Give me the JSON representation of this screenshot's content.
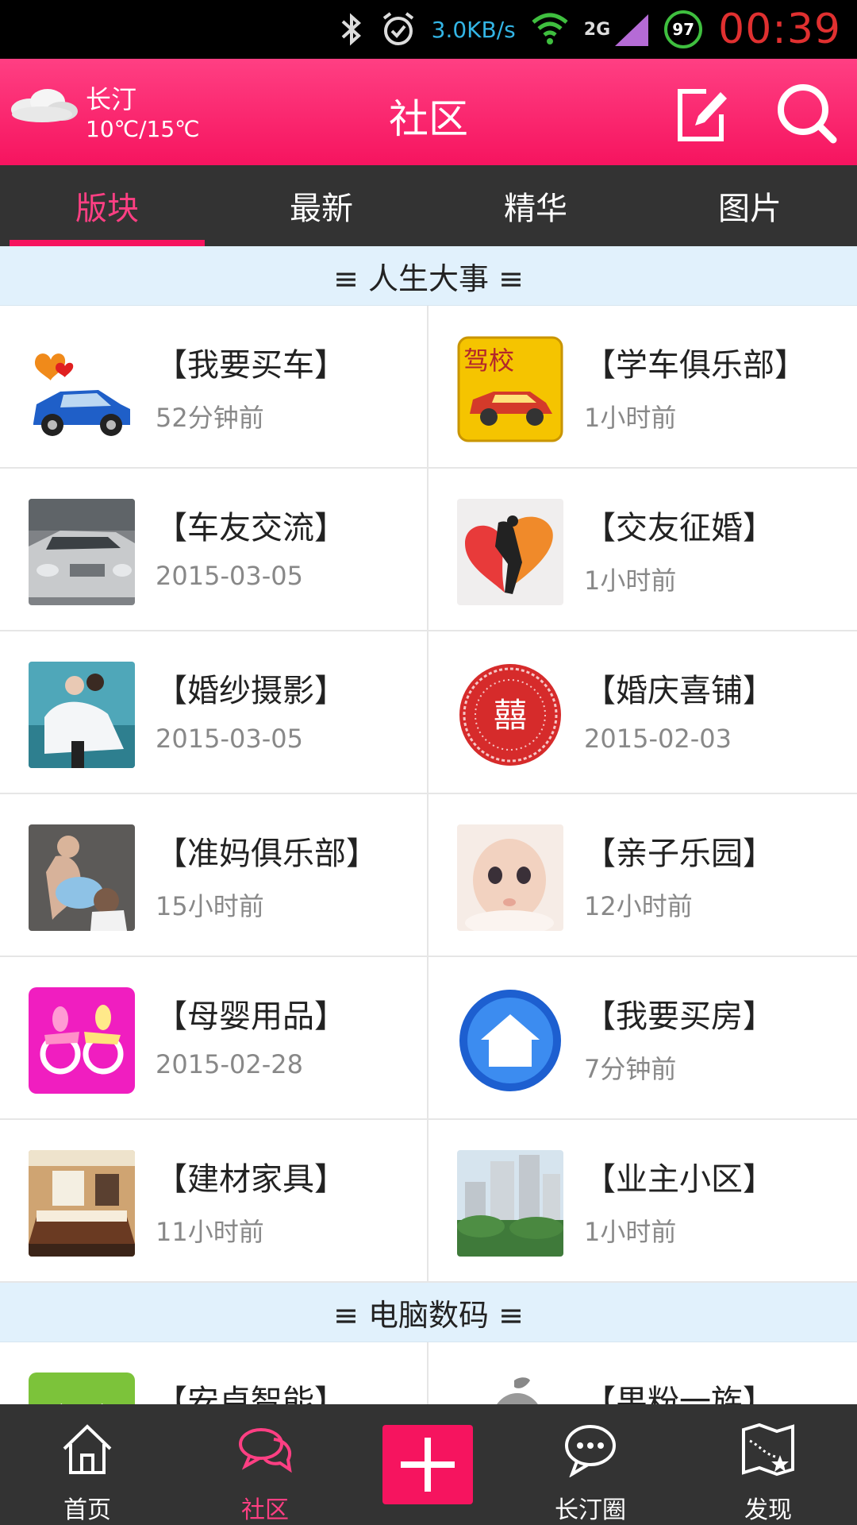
{
  "status_bar": {
    "net_speed": "3.0KB/s",
    "network_type": "2G",
    "battery": "97",
    "time": "00:39",
    "icons": [
      "bluetooth-icon",
      "alarm-icon",
      "wifi-icon",
      "signal-icon"
    ]
  },
  "header": {
    "weather_city": "长汀",
    "weather_temp": "10℃/15℃",
    "title": "社区",
    "accent_color": "#f6145f"
  },
  "tabs": [
    {
      "label": "版块",
      "active": true
    },
    {
      "label": "最新",
      "active": false
    },
    {
      "label": "精华",
      "active": false
    },
    {
      "label": "图片",
      "active": false
    }
  ],
  "sections": [
    {
      "title": "≡ 人生大事 ≡",
      "items": [
        {
          "name": "【我要买车】",
          "time": "52分钟前",
          "icon": "car-thumb"
        },
        {
          "name": "【学车俱乐部】",
          "time": "1小时前",
          "icon": "driving-school-thumb"
        },
        {
          "name": "【车友交流】",
          "time": "2015-03-05",
          "icon": "silver-car-thumb"
        },
        {
          "name": "【交友征婚】",
          "time": "1小时前",
          "icon": "heart-couple-thumb"
        },
        {
          "name": "【婚纱摄影】",
          "time": "2015-03-05",
          "icon": "wedding-photo-thumb"
        },
        {
          "name": "【婚庆喜铺】",
          "time": "2015-02-03",
          "icon": "double-happiness-thumb"
        },
        {
          "name": "【准妈俱乐部】",
          "time": "15小时前",
          "icon": "pregnant-couple-thumb"
        },
        {
          "name": "【亲子乐园】",
          "time": "12小时前",
          "icon": "baby-thumb"
        },
        {
          "name": "【母婴用品】",
          "time": "2015-02-28",
          "icon": "pacifier-thumb"
        },
        {
          "name": "【我要买房】",
          "time": "7分钟前",
          "icon": "house-thumb"
        },
        {
          "name": "【建材家具】",
          "time": "11小时前",
          "icon": "bedroom-thumb"
        },
        {
          "name": "【业主小区】",
          "time": "1小时前",
          "icon": "apartment-thumb"
        }
      ]
    },
    {
      "title": "≡ 电脑数码 ≡",
      "items": [
        {
          "name": "【安卓智能】",
          "time": "",
          "icon": "android-thumb"
        },
        {
          "name": "【果粉一族】",
          "time": "",
          "icon": "apple-thumb"
        }
      ]
    }
  ],
  "bottom_nav": [
    {
      "label": "首页",
      "icon": "home-icon",
      "active": false
    },
    {
      "label": "社区",
      "icon": "chat-bubbles-icon",
      "active": true
    },
    {
      "label": "",
      "icon": "plus-icon",
      "active": false
    },
    {
      "label": "长汀圈",
      "icon": "speech-bubble-icon",
      "active": false
    },
    {
      "label": "发现",
      "icon": "map-icon",
      "active": false
    }
  ]
}
